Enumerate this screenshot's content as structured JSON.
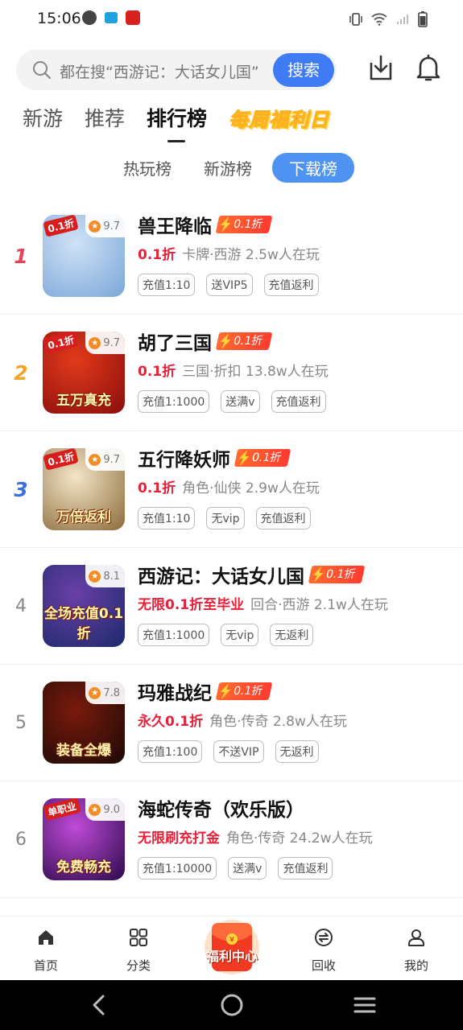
{
  "status_bar": {
    "time": "15:06"
  },
  "search": {
    "placeholder": "都在搜“西游记：大话女儿国”",
    "button_label": "搜索"
  },
  "main_tabs": [
    {
      "label": "新游"
    },
    {
      "label": "推荐"
    },
    {
      "label": "排行榜",
      "active": true
    }
  ],
  "welfare_tab": {
    "label": "每周福利日"
  },
  "sub_tabs": [
    {
      "label": "热玩榜"
    },
    {
      "label": "新游榜"
    },
    {
      "label": "下载榜",
      "active": true
    }
  ],
  "games": [
    {
      "rank": "1",
      "name": "兽王降临",
      "badge": "0.1折",
      "rating": "9.7",
      "promo": "0.1折",
      "meta": "卡牌·西游  2.5w人在玩",
      "tags": [
        "充值1:10",
        "送VIP5",
        "充值返利"
      ],
      "icon_tag": "0.1折",
      "icon_caption": "",
      "icon_colors": [
        "#cfe2f6",
        "#7aa6d8"
      ]
    },
    {
      "rank": "2",
      "name": "胡了三国",
      "badge": "0.1折",
      "rating": "9.7",
      "promo": "0.1折",
      "meta": "三国·折扣  13.8w人在玩",
      "tags": [
        "充值1:1000",
        "送满v",
        "充值返利"
      ],
      "icon_tag": "0.1折",
      "icon_caption": "五万真充",
      "icon_colors": [
        "#e23a1a",
        "#8a0d0d"
      ]
    },
    {
      "rank": "3",
      "name": "五行降妖师",
      "badge": "0.1折",
      "rating": "9.7",
      "promo": "0.1折",
      "meta": "角色·仙侠  2.9w人在玩",
      "tags": [
        "充值1:10",
        "无vip",
        "充值返利"
      ],
      "icon_tag": "0.1折",
      "icon_caption": "万倍返利",
      "icon_colors": [
        "#f3e6c8",
        "#8c6a3a"
      ]
    },
    {
      "rank": "4",
      "name": "西游记：大话女儿国",
      "badge": "0.1折",
      "rating": "8.1",
      "promo": "无限0.1折至毕业",
      "meta": "回合·西游  2.1w人在玩",
      "tags": [
        "充值1:1000",
        "无vip",
        "无返利"
      ],
      "icon_tag": "",
      "icon_caption": "全场充值0.1折",
      "icon_colors": [
        "#6a3fa8",
        "#1c2a6b"
      ]
    },
    {
      "rank": "5",
      "name": "玛雅战纪",
      "badge": "0.1折",
      "rating": "7.8",
      "promo": "永久0.1折",
      "meta": "角色·传奇  2.8w人在玩",
      "tags": [
        "充值1:100",
        "不送VIP",
        "无返利"
      ],
      "icon_tag": "",
      "icon_caption": "装备全爆",
      "icon_colors": [
        "#7a1a0c",
        "#1b0a05"
      ]
    },
    {
      "rank": "6",
      "name": "海蛇传奇（欢乐版）",
      "badge": "",
      "rating": "9.0",
      "promo": "无限刷充打金",
      "meta": "角色·传奇  24.2w人在玩",
      "tags": [
        "充值1:10000",
        "送满v",
        "充值返利"
      ],
      "icon_tag": "单职业",
      "icon_caption": "免费畅充",
      "icon_colors": [
        "#c04ad8",
        "#2a0a4a"
      ]
    }
  ],
  "bottom_nav": [
    {
      "label": "首页",
      "icon": "home-icon"
    },
    {
      "label": "分类",
      "icon": "category-icon"
    },
    {
      "label": "福利中心",
      "icon": "red-envelope-icon"
    },
    {
      "label": "回收",
      "icon": "recycle-icon"
    },
    {
      "label": "我的",
      "icon": "profile-icon"
    }
  ],
  "colors": {
    "accent_blue": "#3f7bf5",
    "promo_red": "#e8213b",
    "rank1": "#e8435a",
    "rank2": "#f3a22a",
    "rank3": "#3d6fe0"
  }
}
